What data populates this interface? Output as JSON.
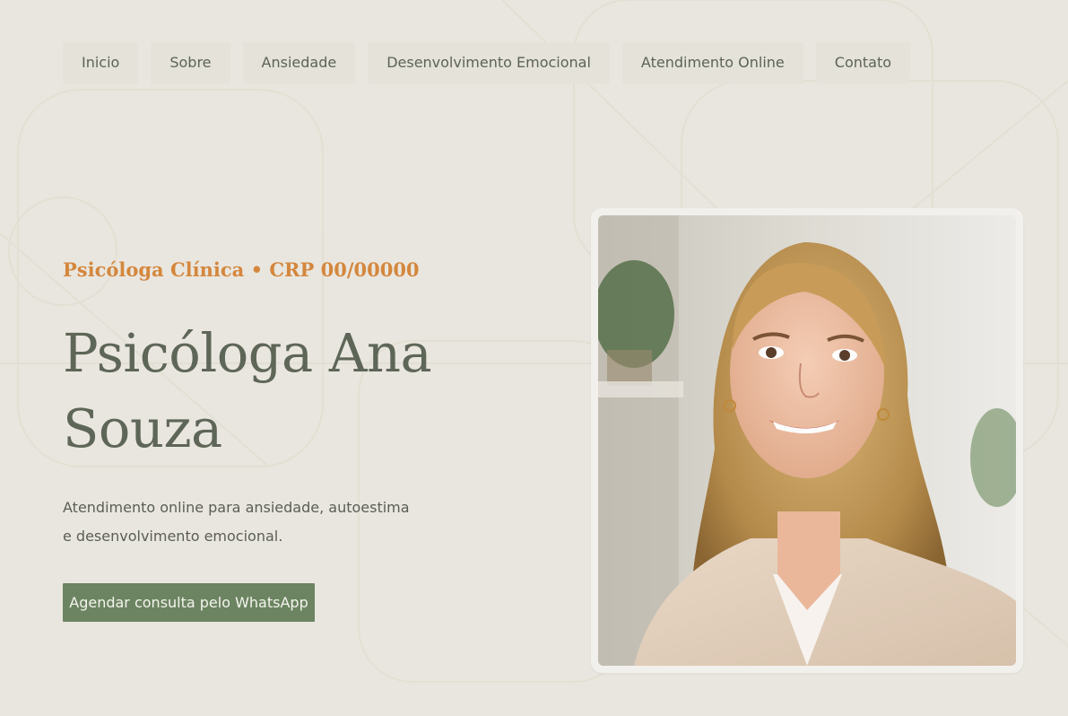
{
  "nav": {
    "items": [
      {
        "label": "Inicio"
      },
      {
        "label": "Sobre"
      },
      {
        "label": "Ansiedade"
      },
      {
        "label": "Desenvolvimento Emocional"
      },
      {
        "label": "Atendimento Online"
      },
      {
        "label": "Contato"
      }
    ]
  },
  "hero": {
    "eyebrow": "Psicóloga Clínica • CRP 00/00000",
    "title": "Psicóloga Ana Souza",
    "subtitle": "Atendimento online para ansiedade, autoestima e desenvolvimento emocional.",
    "cta_label": "Agendar consulta pelo WhatsApp"
  },
  "colors": {
    "background": "#e9e6df",
    "accent": "#d4873d",
    "heading": "#5e6658",
    "button": "#6c8461"
  }
}
